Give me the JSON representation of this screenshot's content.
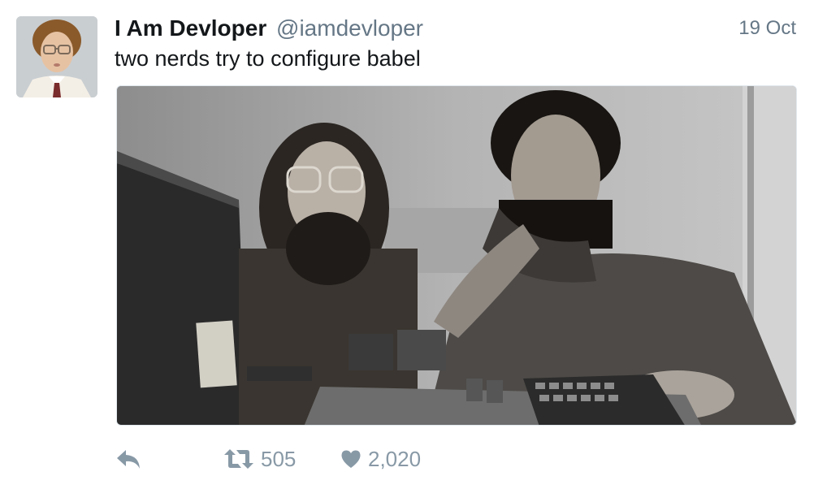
{
  "tweet": {
    "author": {
      "display_name": "I Am Devloper",
      "handle": "@iamdevloper",
      "avatar_icon": "avatar-photo"
    },
    "date": "19 Oct",
    "text": "two nerds try to configure babel",
    "media": {
      "type": "photo"
    },
    "actions": {
      "reply_icon": "reply-icon",
      "retweet_icon": "retweet-icon",
      "retweet_count": "505",
      "like_icon": "heart-icon",
      "like_count": "2,020"
    },
    "colors": {
      "text": "#14171a",
      "secondary": "#657786",
      "action_gray": "#8899a6"
    }
  }
}
